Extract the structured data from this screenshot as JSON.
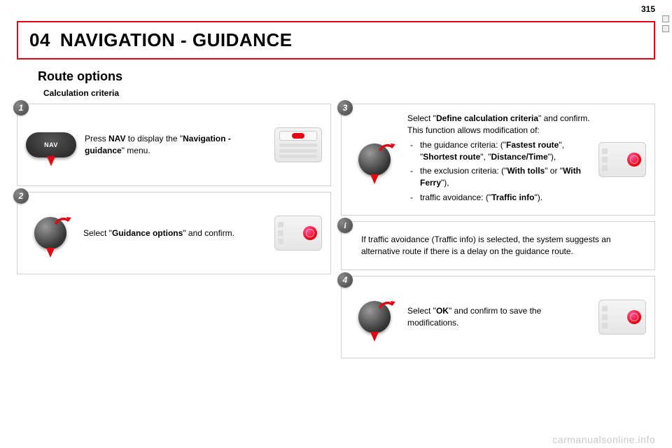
{
  "page_number": "315",
  "chapter": {
    "num": "04",
    "title": "NAVIGATION - GUIDANCE"
  },
  "section_title": "Route options",
  "subsection_title": "Calculation criteria",
  "watermark": "carmanualsonline.info",
  "steps": {
    "s1": {
      "badge": "1",
      "text_pre": "Press ",
      "text_bold1": "NAV",
      "text_mid": " to display the \"",
      "text_bold2": "Navigation - guidance",
      "text_post": "\" menu."
    },
    "s2": {
      "badge": "2",
      "text_pre": "Select \"",
      "text_bold": "Guidance options",
      "text_post": "\" and confirm."
    },
    "s3": {
      "badge": "3",
      "line1_pre": "Select \"",
      "line1_bold": "Define calculation criteria",
      "line1_post": "\" and confirm.",
      "line2": "This function allows modification of:",
      "bullet1_pre": "the guidance criteria: (\"",
      "bullet1_b1": "Fastest route",
      "bullet1_mid1": "\", \"",
      "bullet1_b2": "Shortest route",
      "bullet1_mid2": "\", \"",
      "bullet1_b3": "Distance/Time",
      "bullet1_post": "\"),",
      "bullet2_pre": "the exclusion criteria: (\"",
      "bullet2_b1": "With tolls",
      "bullet2_mid": "\" or \"",
      "bullet2_b2": "With Ferry",
      "bullet2_post": "\"),",
      "bullet3_pre": "traffic avoidance: (\"",
      "bullet3_b": "Traffic info",
      "bullet3_post": "\")."
    },
    "info": {
      "badge": "i",
      "text": "If traffic avoidance (Traffic info) is selected, the system suggests an alternative route if there is a delay on the guidance route."
    },
    "s4": {
      "badge": "4",
      "text_pre": "Select \"",
      "text_bold": "OK",
      "text_post": "\" and confirm to save the modifications."
    }
  },
  "nav_button_label": "NAV"
}
